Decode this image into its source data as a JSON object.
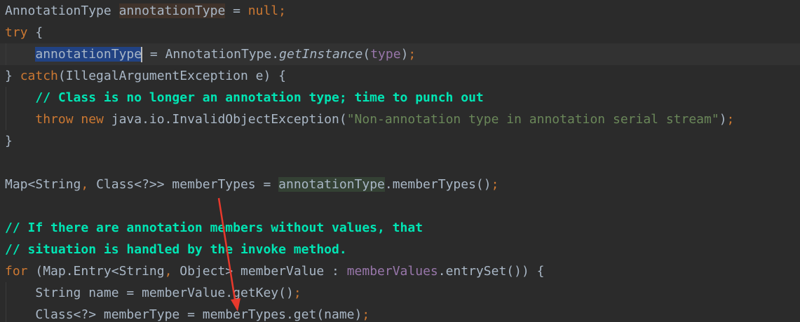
{
  "lines": [
    [
      {
        "t": "AnnotationType ",
        "c": "cls"
      },
      {
        "t": "annotationType",
        "c": "hl-write"
      },
      {
        "t": " = ",
        "c": "cls"
      },
      {
        "t": "null",
        "c": "kw"
      },
      {
        "t": ";",
        "c": "kw"
      }
    ],
    [
      {
        "t": "try",
        "c": "kw"
      },
      {
        "t": " {",
        "c": "cls"
      }
    ],
    [
      {
        "t": "    ",
        "c": "cls"
      },
      {
        "t": "annotationType",
        "c": "hl-sel"
      },
      {
        "t": " = AnnotationType.",
        "c": "cls"
      },
      {
        "t": "getInstance",
        "c": "method-it"
      },
      {
        "t": "(",
        "c": "cls"
      },
      {
        "t": "type",
        "c": "param"
      },
      {
        "t": ")",
        "c": "cls"
      },
      {
        "t": ";",
        "c": "kw"
      }
    ],
    [
      {
        "t": "} ",
        "c": "cls"
      },
      {
        "t": "catch",
        "c": "kw"
      },
      {
        "t": "(IllegalArgumentException e) {",
        "c": "cls"
      }
    ],
    [
      {
        "t": "    ",
        "c": "cls"
      },
      {
        "t": "// Class is no longer an annotation type; time to punch out",
        "c": "comment"
      }
    ],
    [
      {
        "t": "    ",
        "c": "cls"
      },
      {
        "t": "throw new ",
        "c": "kw"
      },
      {
        "t": "java.io.InvalidObjectException(",
        "c": "cls"
      },
      {
        "t": "\"Non-annotation type in annotation serial stream\"",
        "c": "str"
      },
      {
        "t": ")",
        "c": "cls"
      },
      {
        "t": ";",
        "c": "kw"
      }
    ],
    [
      {
        "t": "}",
        "c": "cls"
      }
    ],
    [],
    [
      {
        "t": "Map<String",
        "c": "cls"
      },
      {
        "t": ", ",
        "c": "kw"
      },
      {
        "t": "Class<?>> memberTypes = ",
        "c": "cls"
      },
      {
        "t": "annotationType",
        "c": "hl-read"
      },
      {
        "t": ".memberTypes()",
        "c": "cls"
      },
      {
        "t": ";",
        "c": "kw"
      }
    ],
    [],
    [
      {
        "t": "// If there are annotation members without values, that",
        "c": "comment"
      }
    ],
    [
      {
        "t": "// situation is handled by the invoke method.",
        "c": "comment"
      }
    ],
    [
      {
        "t": "for ",
        "c": "kw"
      },
      {
        "t": "(Map.Entry<String",
        "c": "cls"
      },
      {
        "t": ", ",
        "c": "kw"
      },
      {
        "t": "Object> memberValue : ",
        "c": "cls"
      },
      {
        "t": "memberValues",
        "c": "field"
      },
      {
        "t": ".entrySet()) {",
        "c": "cls"
      }
    ],
    [
      {
        "t": "    String name = memberValue.getKey()",
        "c": "cls"
      },
      {
        "t": ";",
        "c": "kw"
      }
    ],
    [
      {
        "t": "    Class<?> memberType = memberTypes.get(name)",
        "c": "cls"
      },
      {
        "t": ";",
        "c": "kw"
      }
    ]
  ],
  "current_line": 2,
  "caret_line": 2,
  "colors": {
    "background": "#2b2b2b",
    "keyword": "#cc7832",
    "string": "#6a8759",
    "comment": "#00e5b4",
    "field": "#9876aa",
    "arrow": "#e8392c"
  },
  "annotation": {
    "icon": "red-arrow-icon"
  }
}
